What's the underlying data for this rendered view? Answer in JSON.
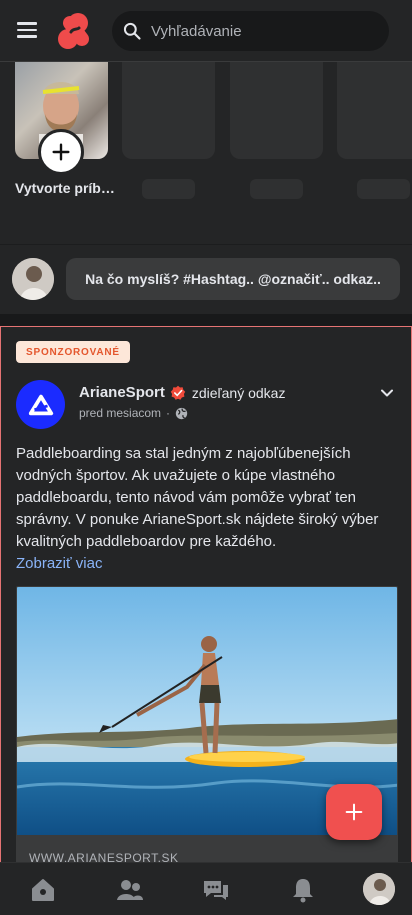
{
  "header": {
    "search_placeholder": "Vyhľadávanie",
    "icons": {
      "menu": "hamburger-icon",
      "logo": "app-logo",
      "search": "search-icon"
    },
    "logo_color": "#ef4b4b"
  },
  "stories": {
    "create_label": "Vytvorte príbeh",
    "icons": {
      "add": "plus-icon"
    }
  },
  "composer": {
    "placeholder": "Na čo myslíš? #Hashtag.. @označiť.. odkaz.."
  },
  "post": {
    "sponsored_label": "SPONZOROVANÉ",
    "author": "ArianeSport",
    "action": "zdieľaný odkaz",
    "time": "pred mesiacom",
    "dot": "·",
    "text": "Paddleboarding sa stal jedným z najobľúbenejších vodných športov. Ak uvažujete o kúpe vlastného paddleboardu, tento návod vám pomôže vybrať ten správny. V ponuke ArianeSport.sk nájdete široký výber kvalitných paddleboardov pre každého.",
    "see_more": "Zobraziť viac",
    "link_domain": "WWW.ARIANESPORT.SK",
    "icons": {
      "verified": "verified-badge-icon",
      "privacy": "globe-icon",
      "options": "chevron-down-icon"
    },
    "accent_color": "#e57373",
    "brand_color": "#1b2bff"
  },
  "fab": {
    "icon": "plus-icon",
    "color": "#f0504f"
  },
  "bottom_nav": {
    "items": [
      "home-icon",
      "friends-icon",
      "messages-icon",
      "notifications-icon",
      "profile-avatar"
    ]
  }
}
